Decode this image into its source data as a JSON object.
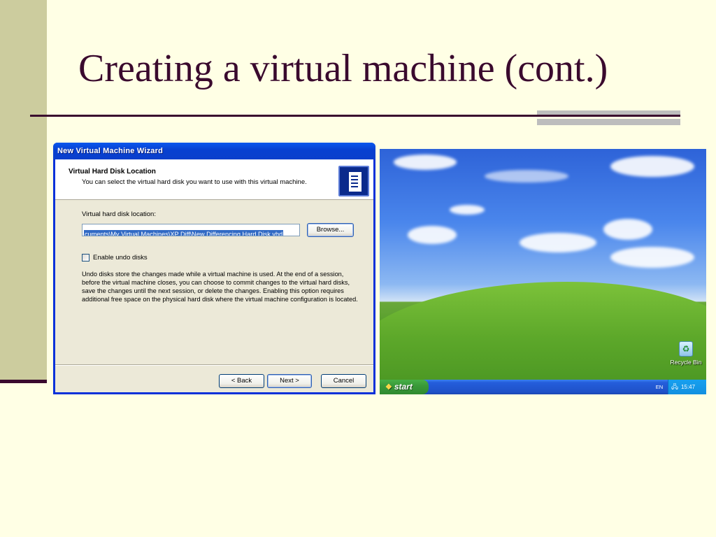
{
  "slide": {
    "title": "Creating a virtual machine (cont.)"
  },
  "wizard": {
    "window_title": "New Virtual Machine Wizard",
    "header_title": "Virtual Hard Disk Location",
    "header_subtitle": "You can select the virtual hard disk you want to use with this virtual machine.",
    "location_label": "Virtual hard disk location:",
    "location_value": "cuments\\My Virtual Machines\\XP Diff\\New Differencing Hard Disk.vhd",
    "browse_label": "Browse...",
    "undo_checkbox_label": "Enable undo disks",
    "undo_checked": false,
    "undo_description": "Undo disks store the changes made while a virtual machine is used. At the end of a session, before the virtual machine closes, you can choose to commit changes to the virtual hard disks, save the changes until the next session, or delete the changes. Enabling this option requires additional free space on the physical hard disk where the virtual machine configuration is located.",
    "back_label": "< Back",
    "next_label": "Next >",
    "cancel_label": "Cancel",
    "logo_icon": "virtual-disk-icon"
  },
  "desktop": {
    "recycle_bin_label": "Recycle Bin",
    "start_label": "start",
    "language": "EN",
    "clock": "15:47"
  },
  "colors": {
    "slide_background": "#FFFFE5",
    "title_color": "#3A0A2E",
    "side_band": "#CCCC9E",
    "xp_titlebar": "#0A58EE",
    "xp_dialog": "#ECE9D8"
  }
}
